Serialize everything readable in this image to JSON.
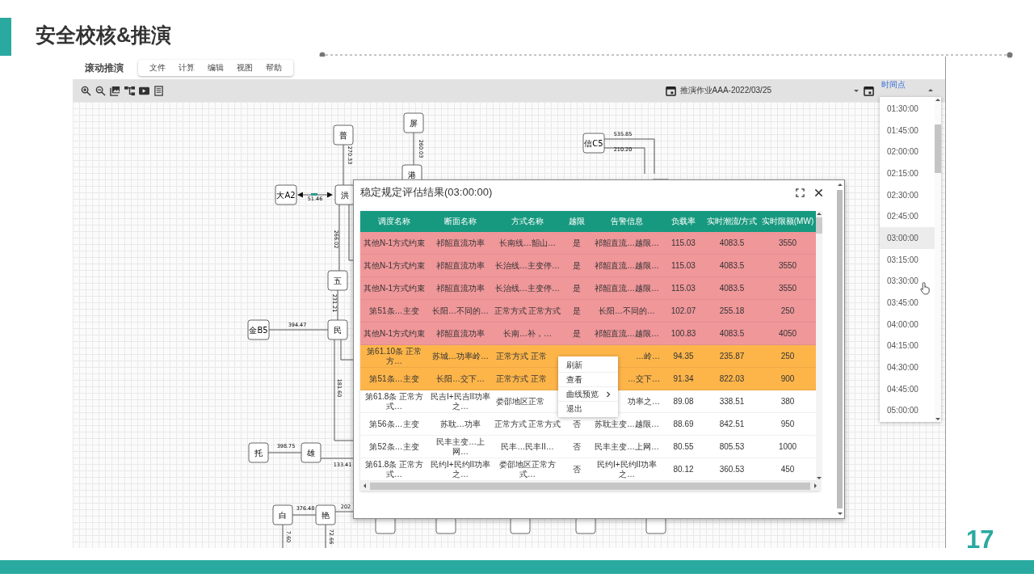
{
  "slide": {
    "title": "安全校核&推演",
    "page_number": "17"
  },
  "app": {
    "title": "滚动推演",
    "menu": [
      "文件",
      "计算",
      "编辑",
      "视图",
      "帮助"
    ],
    "job": "推演作业AAA-2022/03/25",
    "time_label": "时间点"
  },
  "diagram": {
    "nodes": [
      "普",
      "屏",
      "港",
      "大A2",
      "洪",
      "五",
      "金B5",
      "民",
      "托",
      "雄",
      "白",
      "艳",
      "信C5"
    ],
    "flow_labels": [
      "270.33",
      "260.03",
      "51.46",
      "266.02",
      "231.21",
      "394.47",
      "181.60",
      "398.75",
      "133.41",
      "376.48",
      "202",
      "7.60",
      "72.66",
      "535.85",
      "210.20"
    ]
  },
  "dialog": {
    "title": "稳定规定评估结果(03:00:00)",
    "columns": [
      "调度名称",
      "断面名称",
      "方式名称",
      "越限",
      "告警信息",
      "负载率",
      "实时潮流/方式",
      "实时限额(MW)"
    ],
    "rows": [
      {
        "color": "#f0979a",
        "cells": [
          "其他N-1方式约束",
          "祁韶直流功率",
          "长南线…韶山…",
          "是",
          "祁韶直流…越限…",
          "115.03",
          "4083.5",
          "3550"
        ]
      },
      {
        "color": "#f0979a",
        "cells": [
          "其他N-1方式约束",
          "祁韶直流功率",
          "长治线…主变停…",
          "是",
          "祁韶直流…越限…",
          "115.03",
          "4083.5",
          "3550"
        ]
      },
      {
        "color": "#f0979a",
        "cells": [
          "其他N-1方式约束",
          "祁韶直流功率",
          "长治线…主变停…",
          "是",
          "祁韶直流…越限…",
          "115.03",
          "4083.5",
          "3550"
        ]
      },
      {
        "color": "#f0979a",
        "cells": [
          "第51条…主变",
          "长阳…不同的…",
          "正常方式 正常方式",
          "是",
          "长阳…不同的…",
          "102.07",
          "255.18",
          "250"
        ]
      },
      {
        "color": "#f0979a",
        "cells": [
          "其他N-1方式约束",
          "祁韶直流功率",
          "长南…补，…",
          "是",
          "祁韶直流…越限…",
          "100.83",
          "4083.5",
          "4050"
        ]
      },
      {
        "color": "#fdb54a",
        "cells": [
          "第61.10条 正常方…",
          "苏城…功率岭…",
          "正常方式 正常",
          null,
          "…岭…",
          "94.35",
          "235.87",
          "250"
        ]
      },
      {
        "color": "#fdb54a",
        "cells": [
          "第51条…主变",
          "长阳…交下…",
          "正常方式 正常",
          null,
          "…交下…",
          "91.34",
          "822.03",
          "900"
        ]
      },
      {
        "color": "#ffffff",
        "cells": [
          "第61.8条 正常方式…",
          "民吉I+民吉II功率之…",
          "娄邵地区正常",
          null,
          "功率之…",
          "89.08",
          "338.51",
          "380"
        ]
      },
      {
        "color": "#ffffff",
        "cells": [
          "第56条…主变",
          "苏耽…功率",
          "正常方式 正常方式",
          "否",
          "苏耽主变…越限…",
          "88.69",
          "842.51",
          "950"
        ]
      },
      {
        "color": "#ffffff",
        "cells": [
          "第52条…主变",
          "民丰主变…上网…",
          "民丰…民丰II…",
          "否",
          "民丰主变…上网…",
          "80.55",
          "805.53",
          "1000"
        ]
      },
      {
        "color": "#ffffff",
        "cells": [
          "第61.8条 正常方式…",
          "民约I+民约II功率之…",
          "娄邵地区正常方式…",
          "否",
          "民约I+民约II功率之…",
          "80.12",
          "360.53",
          "450"
        ]
      }
    ]
  },
  "context_menu": [
    {
      "label": "刷新",
      "submenu": false
    },
    {
      "label": "查看",
      "submenu": false
    },
    {
      "label": "曲线预览",
      "submenu": true
    },
    {
      "label": "退出",
      "submenu": false
    }
  ],
  "time_list": [
    {
      "label": "01:30:00",
      "selected": false
    },
    {
      "label": "01:45:00",
      "selected": false
    },
    {
      "label": "02:00:00",
      "selected": false
    },
    {
      "label": "02:15:00",
      "selected": false
    },
    {
      "label": "02:30:00",
      "selected": false
    },
    {
      "label": "02:45:00",
      "selected": false
    },
    {
      "label": "03:00:00",
      "selected": true
    },
    {
      "label": "03:15:00",
      "selected": false
    },
    {
      "label": "03:30:00",
      "selected": false
    },
    {
      "label": "03:45:00",
      "selected": false
    },
    {
      "label": "04:00:00",
      "selected": false
    },
    {
      "label": "04:15:00",
      "selected": false
    },
    {
      "label": "04:30:00",
      "selected": false
    },
    {
      "label": "04:45:00",
      "selected": false
    },
    {
      "label": "05:00:00",
      "selected": false
    }
  ]
}
